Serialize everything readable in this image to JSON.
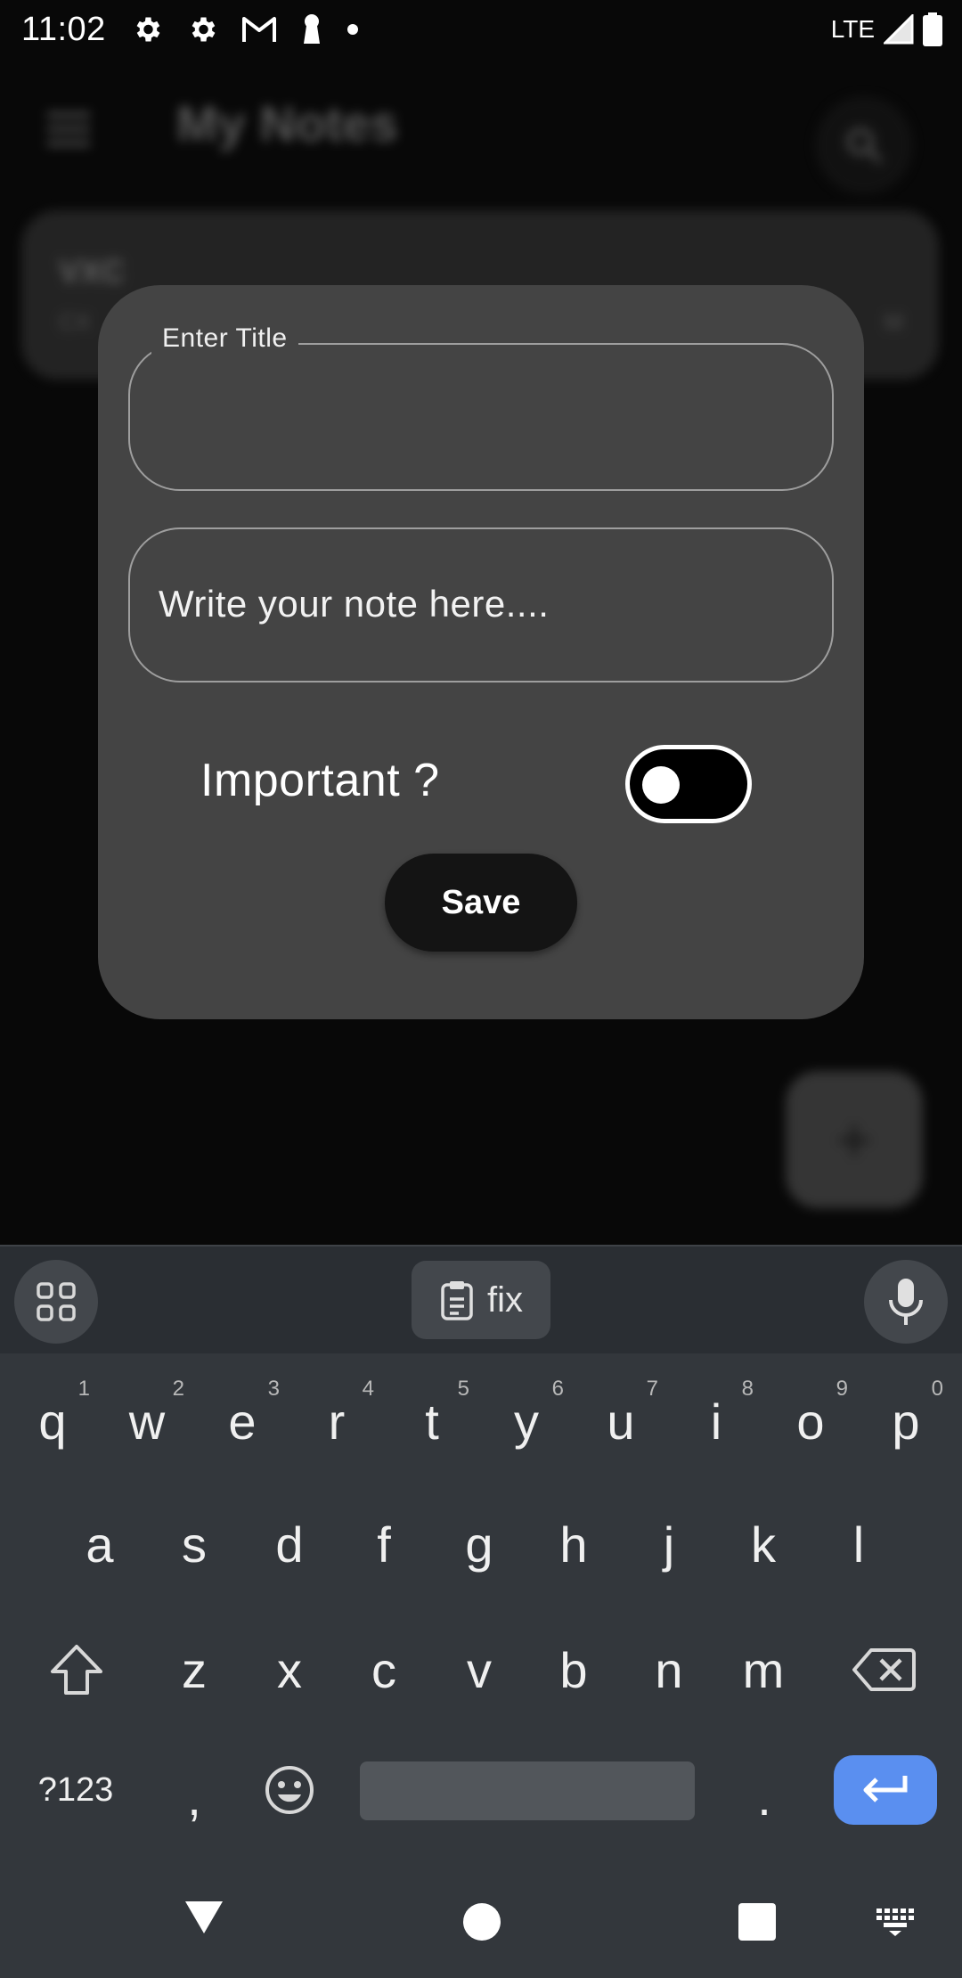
{
  "status_bar": {
    "time": "11:02",
    "network": "LTE",
    "icons": [
      "settings-icon",
      "settings-icon",
      "gmail-icon",
      "keyhole-icon",
      "dot-icon",
      "signal-icon",
      "battery-icon"
    ]
  },
  "background_app": {
    "title": "My Notes",
    "note_card": {
      "title": "VXC",
      "subtitle": "CX",
      "time": "M"
    },
    "fab_symbol": "+"
  },
  "dialog": {
    "title_field": {
      "label": "Enter Title",
      "value": ""
    },
    "note_field": {
      "placeholder": "Write your note here....",
      "value": ""
    },
    "important_label": "Important ?",
    "important_toggle_on": false,
    "save_label": "Save"
  },
  "keyboard": {
    "suggestion": "fix",
    "row1": [
      {
        "key": "q",
        "sup": "1"
      },
      {
        "key": "w",
        "sup": "2"
      },
      {
        "key": "e",
        "sup": "3"
      },
      {
        "key": "r",
        "sup": "4"
      },
      {
        "key": "t",
        "sup": "5"
      },
      {
        "key": "y",
        "sup": "6"
      },
      {
        "key": "u",
        "sup": "7"
      },
      {
        "key": "i",
        "sup": "8"
      },
      {
        "key": "o",
        "sup": "9"
      },
      {
        "key": "p",
        "sup": "0"
      }
    ],
    "row2": [
      "a",
      "s",
      "d",
      "f",
      "g",
      "h",
      "j",
      "k",
      "l"
    ],
    "row3": [
      "z",
      "x",
      "c",
      "v",
      "b",
      "n",
      "m"
    ],
    "symbols_key": "?123",
    "comma_key": ",",
    "period_key": "."
  },
  "colors": {
    "dialog_bg": "#444444",
    "enter_key": "#5a8ff0",
    "keyboard_bg": "#33373c"
  }
}
